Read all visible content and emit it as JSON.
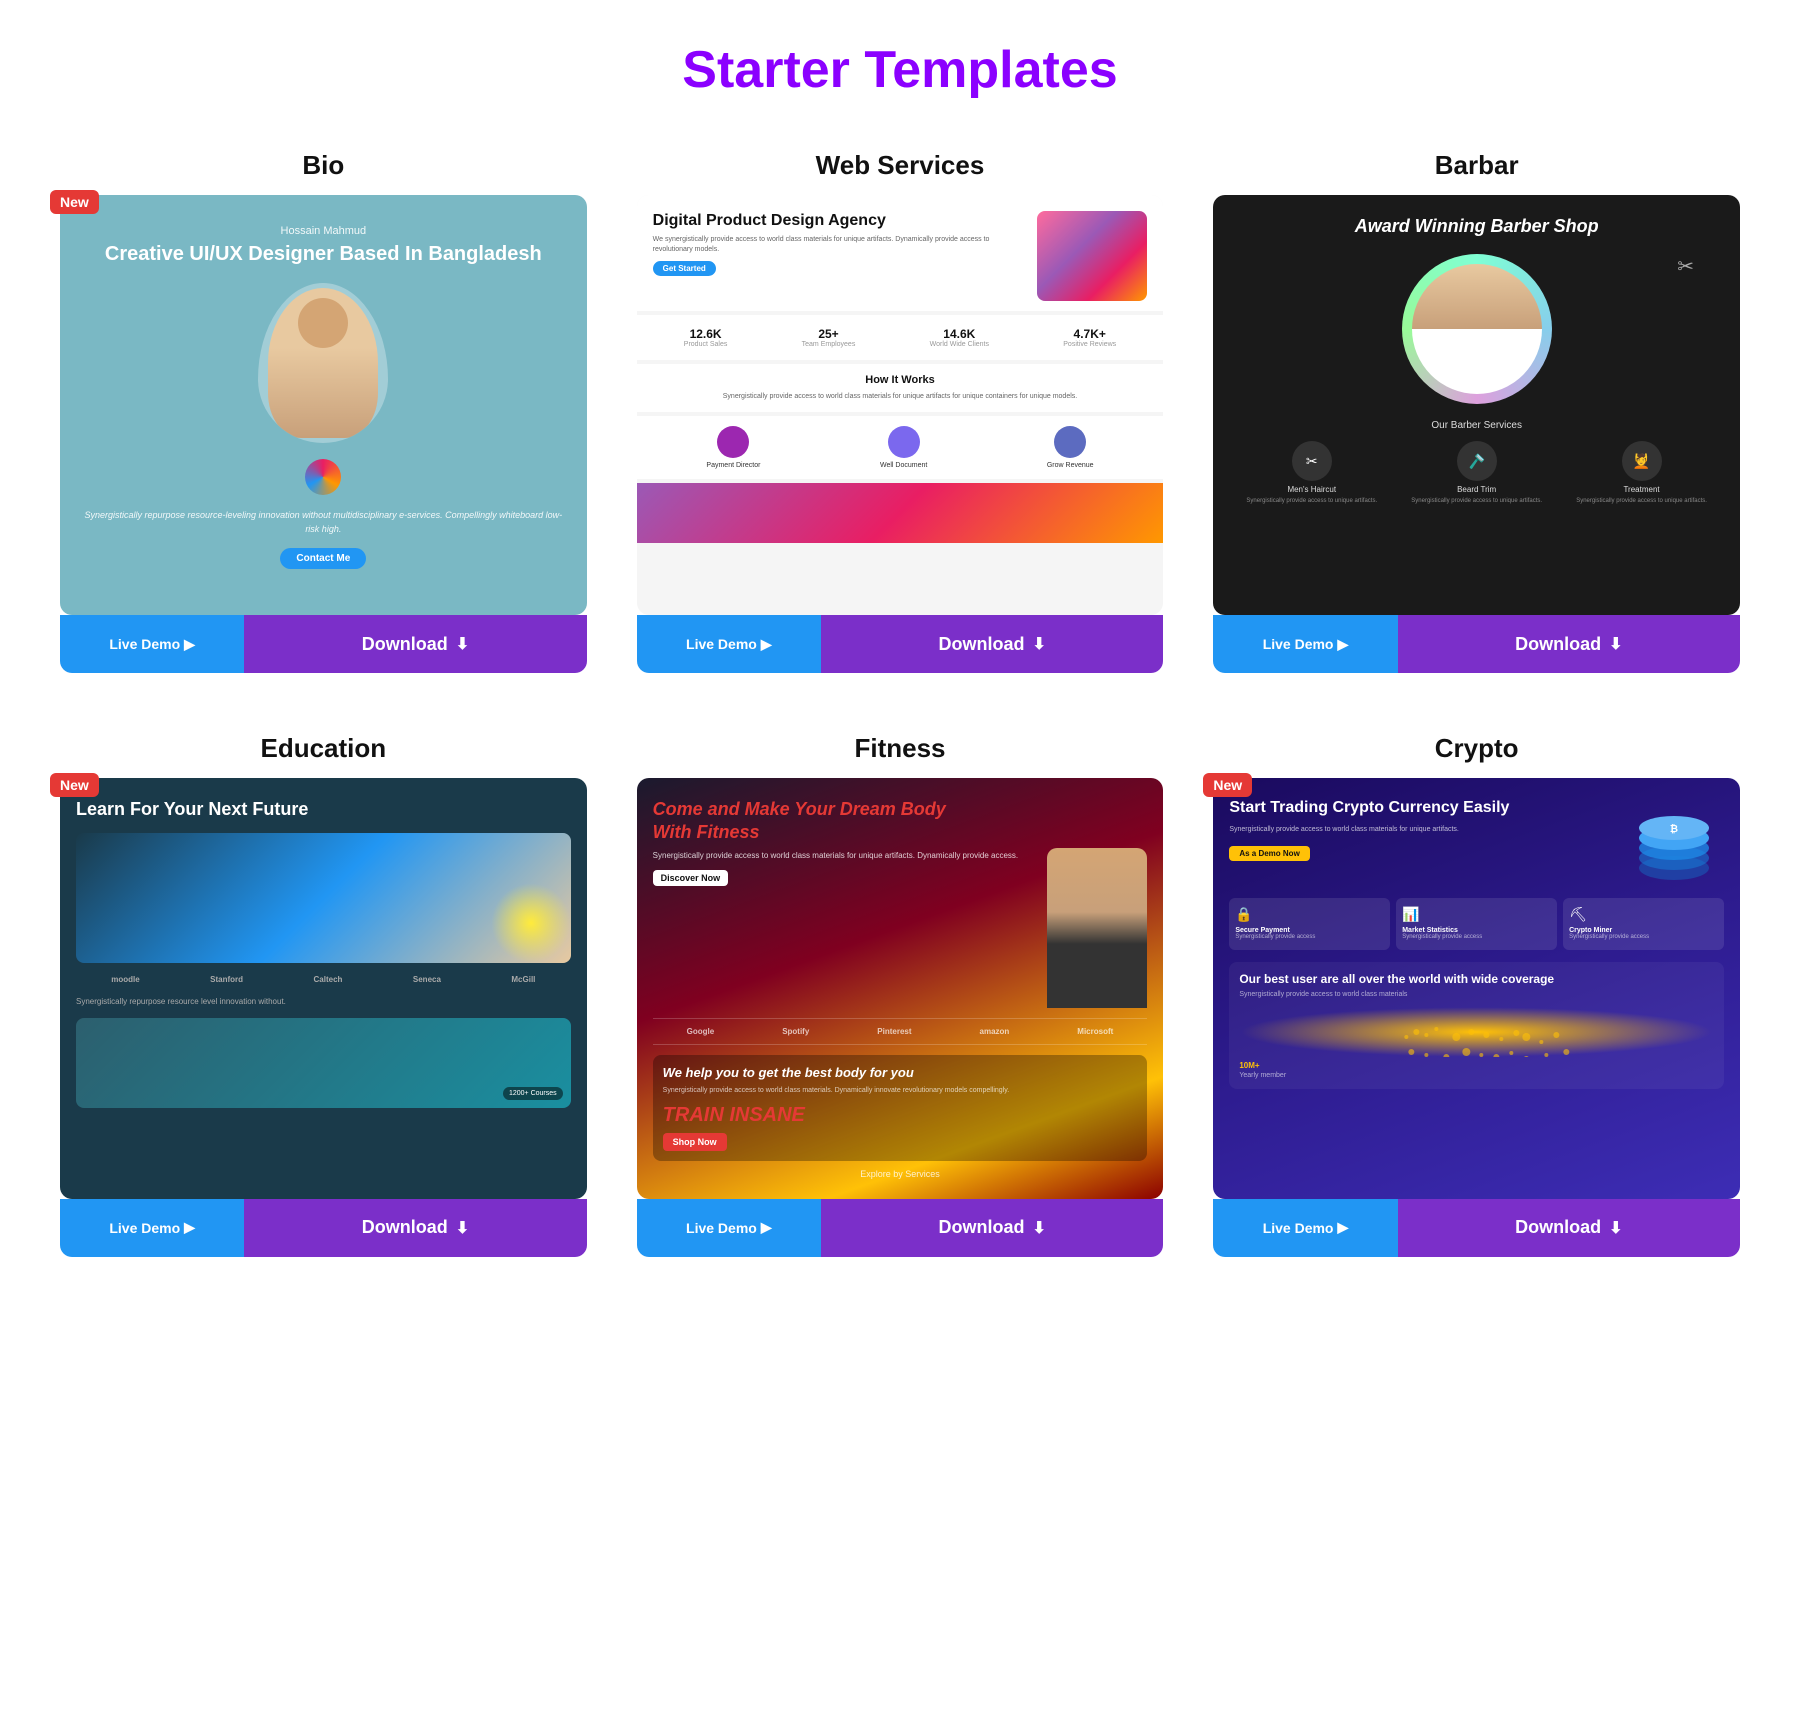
{
  "page": {
    "title": "Starter Templates"
  },
  "templates": [
    {
      "id": "bio",
      "title": "Bio",
      "isNew": true,
      "preview": {
        "type": "bio",
        "name": "Hossain Mahmud",
        "headline": "Creative UI/UX Designer Based In Bangladesh",
        "desc": "Synergistically repurpose resource-leveling innovation without multidisciplinary e-services. Compellingly whiteboard low-risk high."
      },
      "liveDemoLabel": "Live Demo",
      "downloadLabel": "Download"
    },
    {
      "id": "web-services",
      "title": "Web Services",
      "isNew": false,
      "preview": {
        "type": "webservices",
        "heroTitle": "Digital Product Design Agency",
        "stats": [
          {
            "val": "12.6K",
            "lbl": "Product Sales"
          },
          {
            "val": "25+",
            "lbl": "Team Employees"
          },
          {
            "val": "14.6K",
            "lbl": "World Wide Clients"
          },
          {
            "val": "4.7K+",
            "lbl": "Positive Reviews"
          }
        ],
        "howItWorks": "How It Works",
        "features": [
          "Payment Director",
          "Well Document",
          "Grow Revenue"
        ]
      },
      "liveDemoLabel": "Live Demo",
      "downloadLabel": "Download"
    },
    {
      "id": "barbar",
      "title": "Barbar",
      "isNew": false,
      "preview": {
        "type": "barbar",
        "headline": "Award Winning Barber Shop",
        "servicesTitle": "Our Barber Services",
        "services": [
          {
            "name": "Men's Haircut",
            "icon": "✂"
          },
          {
            "name": "Beard Trim",
            "icon": "🪒"
          },
          {
            "name": "Treatment",
            "icon": "💆"
          }
        ]
      },
      "liveDemoLabel": "Live Demo",
      "downloadLabel": "Download"
    },
    {
      "id": "education",
      "title": "Education",
      "isNew": true,
      "preview": {
        "type": "education",
        "headline": "Learn For Your Next Future",
        "logos": [
          "moodle",
          "Stanford",
          "Caltech",
          "Seneca",
          "McGill"
        ],
        "desc": "Synergistically repurpose resource level innovation without.",
        "coursesBadge": "1200+ Courses"
      },
      "liveDemoLabel": "Live Demo",
      "downloadLabel": "Download"
    },
    {
      "id": "fitness",
      "title": "Fitness",
      "isNew": false,
      "preview": {
        "type": "fitness",
        "headline": "Come and Make Your Dream Body",
        "headlineHighlight": "With Fitness",
        "brands": [
          "Google",
          "Spotify",
          "Pinterest",
          "amazon",
          "Microsoft"
        ],
        "bottomHeadline": "We help you to get the best body for you",
        "trainLabel": "TRAIN INSANE",
        "exploreLabel": "Explore by Services"
      },
      "liveDemoLabel": "Live Demo",
      "downloadLabel": "Download"
    },
    {
      "id": "crypto",
      "title": "Crypto",
      "isNew": true,
      "preview": {
        "type": "crypto",
        "headline": "Start Trading Crypto Currency Easily",
        "desc": "Synergistically provide access to world class materials for unique artifacts.",
        "ctaLabel": "As a Demo Now",
        "features": [
          {
            "icon": "🔒",
            "name": "Secure Payment",
            "desc": "Synergistically provide access"
          },
          {
            "icon": "📊",
            "name": "Market Statistics",
            "desc": "Synergistically provide access"
          },
          {
            "icon": "⛏",
            "name": "Crypto Miner",
            "desc": "Synergistically provide access"
          }
        ],
        "worldHeadline": "Our best user are all over the world with wide coverage",
        "worldDesc": "Synergistically provide access to world class materials",
        "usersCount": "10M+",
        "usersFooter": "Yearly member"
      },
      "liveDemoLabel": "Live Demo",
      "downloadLabel": "Download"
    }
  ],
  "badges": {
    "new": "New"
  }
}
